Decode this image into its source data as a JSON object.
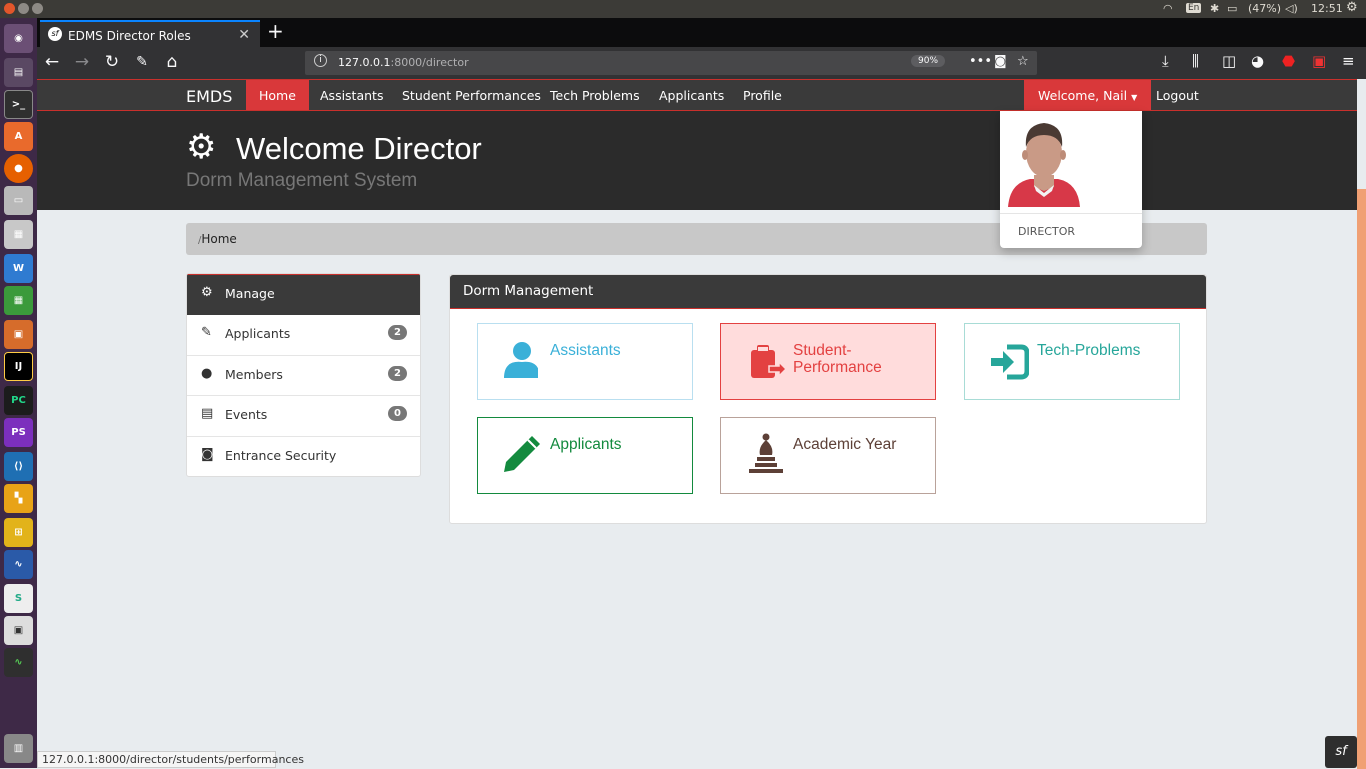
{
  "system": {
    "language": "En",
    "battery": "(47%)",
    "clock": "12:51"
  },
  "browser": {
    "tab_title": "EDMS Director Roles",
    "url_host": "127.0.0.1",
    "url_rest": ":8000/director",
    "zoom": "90%",
    "status_url": "127.0.0.1:8000/director/students/performances"
  },
  "nav": {
    "brand": "EMDS",
    "items": [
      "Home",
      "Assistants",
      "Student Performances",
      "Tech Problems",
      "Applicants",
      "Profile"
    ],
    "welcome": "Welcome, Nail",
    "logout": "Logout"
  },
  "header": {
    "title": "Welcome Director",
    "subtitle": "Dorm Management System"
  },
  "breadcrumb": {
    "sep": "/",
    "current": "Home"
  },
  "sidebar": {
    "title": "Manage",
    "items": [
      {
        "label": "Applicants",
        "count": "2"
      },
      {
        "label": "Members",
        "count": "2"
      },
      {
        "label": "Events",
        "count": "0"
      },
      {
        "label": "Entrance Security"
      }
    ]
  },
  "panel": {
    "title": "Dorm Management",
    "tiles": [
      {
        "label": "Assistants",
        "color": "#3ab0d8",
        "icon": "user-icon"
      },
      {
        "label_line1": "Student-",
        "label_line2": "Performance",
        "color": "#e34141",
        "icon": "clipboard-icon"
      },
      {
        "label": "Tech-Problems",
        "color": "#26a69a",
        "icon": "sign-in-icon"
      },
      {
        "label": "Applicants",
        "color": "#138a3e",
        "icon": "pencil-icon"
      },
      {
        "label": "Academic Year",
        "color": "#5d4037",
        "icon": "chess-bishop-icon"
      }
    ]
  },
  "dropdown": {
    "role": "DIRECTOR"
  },
  "colors": {
    "accent": "#d9383a",
    "nav_bg": "#3a3a3a",
    "header_bg": "#2b2b2b"
  }
}
